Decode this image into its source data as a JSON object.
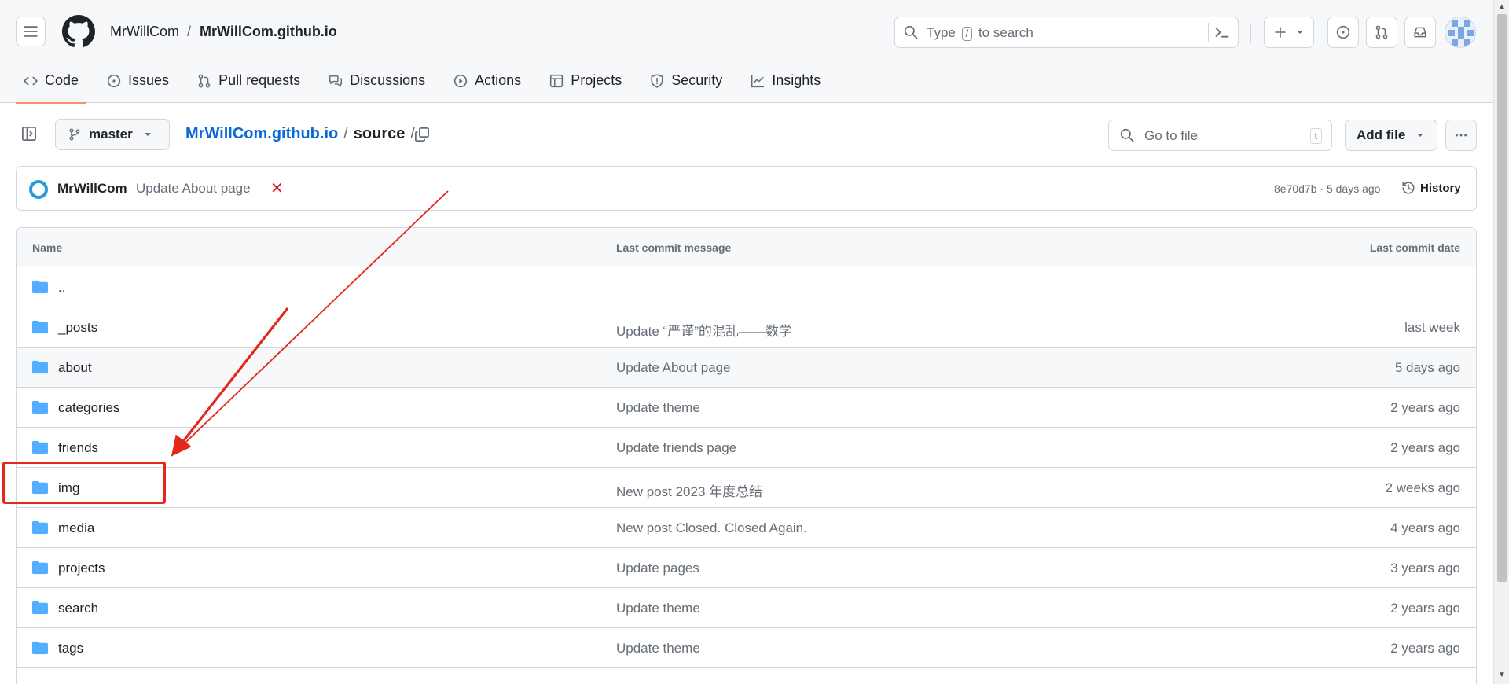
{
  "header": {
    "owner": "MrWillCom",
    "separator": "/",
    "repo": "MrWillCom.github.io",
    "search": {
      "prefix": "Type",
      "key": "/",
      "suffix": "to search"
    }
  },
  "tabs": [
    {
      "label": "Code",
      "icon": "code-icon"
    },
    {
      "label": "Issues",
      "icon": "issue-icon"
    },
    {
      "label": "Pull requests",
      "icon": "pull-request-icon"
    },
    {
      "label": "Discussions",
      "icon": "discussion-icon"
    },
    {
      "label": "Actions",
      "icon": "play-icon"
    },
    {
      "label": "Projects",
      "icon": "table-icon"
    },
    {
      "label": "Security",
      "icon": "shield-icon"
    },
    {
      "label": "Insights",
      "icon": "graph-icon"
    }
  ],
  "subheader": {
    "branch": "master",
    "path_repo": "MrWillCom.github.io",
    "path_sep": "/",
    "path_dir": "source",
    "path_trailing": "/",
    "goto_placeholder": "Go to file",
    "goto_key": "t",
    "add_file": "Add file"
  },
  "commit": {
    "author": "MrWillCom",
    "message": "Update About page",
    "status": "✕",
    "meta": "8e70d7b · 5 days ago",
    "history": "History"
  },
  "table": {
    "headers": {
      "name": "Name",
      "message": "Last commit message",
      "date": "Last commit date"
    },
    "rows": [
      {
        "name": "..",
        "message": "",
        "date": ""
      },
      {
        "name": "_posts",
        "message": "Update “严谨”的混乱——数学",
        "date": "last week"
      },
      {
        "name": "about",
        "message": "Update About page",
        "date": "5 days ago"
      },
      {
        "name": "categories",
        "message": "Update theme",
        "date": "2 years ago"
      },
      {
        "name": "friends",
        "message": "Update friends page",
        "date": "2 years ago"
      },
      {
        "name": "img",
        "message": "New post 2023 年度总结",
        "date": "2 weeks ago"
      },
      {
        "name": "media",
        "message": "New post Closed. Closed Again.",
        "date": "4 years ago"
      },
      {
        "name": "projects",
        "message": "Update pages",
        "date": "3 years ago"
      },
      {
        "name": "search",
        "message": "Update theme",
        "date": "2 years ago"
      },
      {
        "name": "tags",
        "message": "Update theme",
        "date": "2 years ago"
      }
    ]
  },
  "colors": {
    "accent_link": "#0969da",
    "tab_underline": "#fd8c73",
    "folder": "#54aeff",
    "annotation": "#e3271c",
    "error": "#cf222e"
  }
}
